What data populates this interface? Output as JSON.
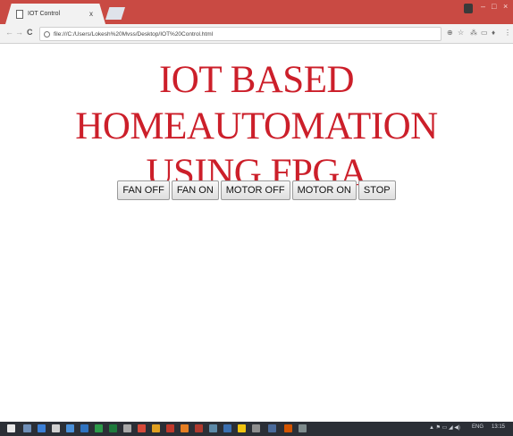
{
  "browser": {
    "tab_title": "IOT Control",
    "tab_close": "x",
    "url": "file:///C:/Users/Lokesh%20Mvss/Desktop/IOT%20Control.html",
    "window_controls": {
      "minimize": "–",
      "maximize": "□",
      "close": "×"
    }
  },
  "page": {
    "heading_line1": "IOT BASED HOMEAUTOMATION",
    "heading_line2": "USING FPGA",
    "heading_color": "#cc1f2a",
    "buttons": [
      {
        "label": "FAN OFF"
      },
      {
        "label": "FAN ON"
      },
      {
        "label": "MOTOR OFF"
      },
      {
        "label": "MOTOR ON"
      },
      {
        "label": "STOP"
      }
    ]
  },
  "taskbar": {
    "language": "ENG",
    "clock": "13:15"
  }
}
